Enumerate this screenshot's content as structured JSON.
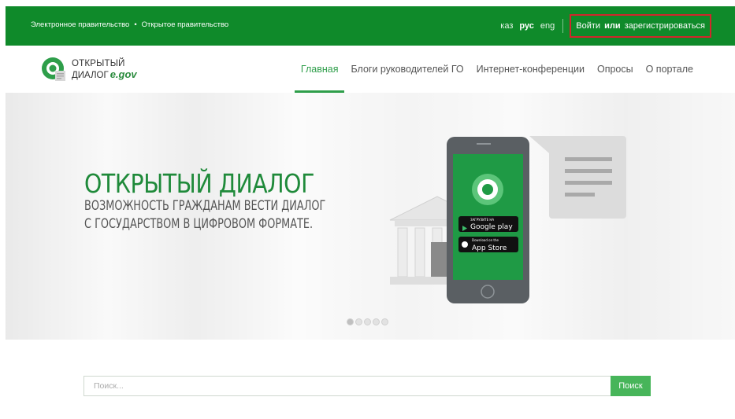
{
  "topbar": {
    "links": [
      "Электронное правительство",
      "Открытое правительство"
    ],
    "separator": "•",
    "languages": [
      {
        "label": "каз",
        "active": false
      },
      {
        "label": "рус",
        "active": true
      },
      {
        "label": "eng",
        "active": false
      }
    ],
    "login": "Войти",
    "or": "или",
    "register": "зарегистрироваться"
  },
  "logo": {
    "line1": "ОТКРЫТЫЙ",
    "line2": "ДИАЛОГ",
    "egov": "e.gov",
    "icon": "open-dialog-logo-icon"
  },
  "nav": {
    "items": [
      {
        "label": "Главная",
        "active": true
      },
      {
        "label": "Блоги руководителей ГО",
        "active": false
      },
      {
        "label": "Интернет-конференции",
        "active": false
      },
      {
        "label": "Опросы",
        "active": false
      },
      {
        "label": "О портале",
        "active": false
      }
    ]
  },
  "hero": {
    "title": "ОТКРЫТЫЙ ДИАЛОГ",
    "subtitle_line1": "ВОЗМОЖНОСТЬ ГРАЖДАНАМ ВЕСТИ ДИАЛОГ",
    "subtitle_line2": "С ГОСУДАРСТВОМ В ЦИФРОВОМ ФОРМАТЕ.",
    "google_play_small": "ЗАГРУЗИТЕ НА",
    "google_play": "Google play",
    "app_store_small": "Download on the",
    "app_store": "App Store",
    "slides_total": 5,
    "slide_active": 1
  },
  "search": {
    "placeholder": "Поиск...",
    "button": "Поиск"
  },
  "colors": {
    "brand_green": "#0f8a2a",
    "accent_green": "#2e9e4a",
    "button_green": "#47b55a",
    "highlight_red": "#d1262b"
  }
}
